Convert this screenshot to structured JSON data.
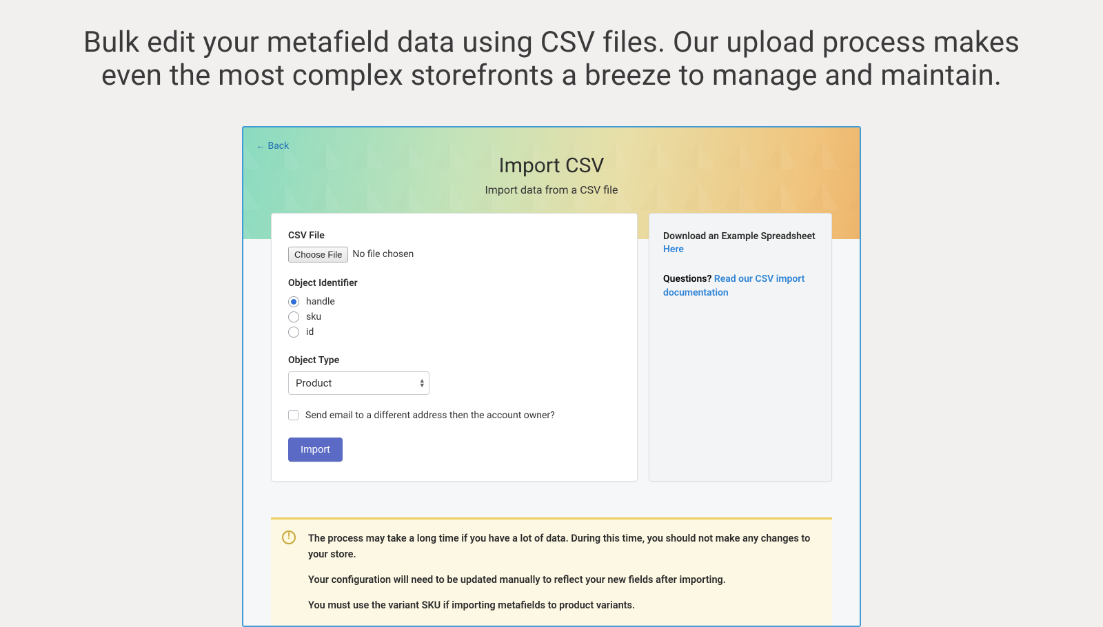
{
  "heading": "Bulk edit your metafield data using CSV files. Our upload process makes even the most complex storefronts a breeze to manage and maintain.",
  "back_label": "← Back",
  "page_title": "Import CSV",
  "page_subtitle": "Import data from a CSV file",
  "form": {
    "csv_file_label": "CSV File",
    "choose_file_button": "Choose File",
    "file_chosen_text": "No file chosen",
    "object_identifier_label": "Object Identifier",
    "radios": [
      {
        "label": "handle",
        "selected": true
      },
      {
        "label": "sku",
        "selected": false
      },
      {
        "label": "id",
        "selected": false
      }
    ],
    "object_type_label": "Object Type",
    "object_type_value": "Product",
    "email_checkbox_label": "Send email to a different address then the account owner?",
    "email_checkbox_checked": false,
    "import_button": "Import"
  },
  "sidebar": {
    "example_text": "Download an Example Spreadsheet ",
    "example_link": "Here",
    "questions_lead": "Questions? ",
    "questions_link": "Read our CSV import documentation"
  },
  "warning": {
    "line1": "The process may take a long time if you have a lot of data. During this time, you should not make any changes to your store.",
    "line2": "Your configuration will need to be updated manually to reflect your new fields after importing.",
    "line3": "You must use the variant SKU if importing metafields to product variants."
  }
}
